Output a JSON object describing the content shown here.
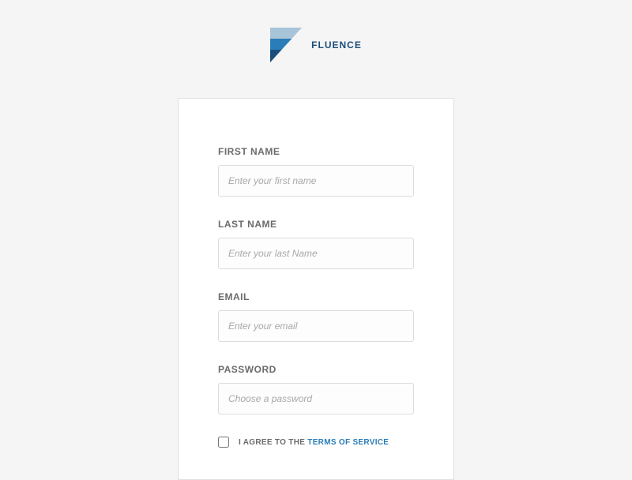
{
  "brand": {
    "name": "FLUENCE"
  },
  "form": {
    "first_name": {
      "label": "FIRST NAME",
      "placeholder": "Enter your first name",
      "value": ""
    },
    "last_name": {
      "label": "LAST NAME",
      "placeholder": "Enter your last Name",
      "value": ""
    },
    "email": {
      "label": "EMAIL",
      "placeholder": "Enter your email",
      "value": ""
    },
    "password": {
      "label": "PASSWORD",
      "placeholder": "Choose a password",
      "value": ""
    },
    "terms": {
      "prefix": "I AGREE TO THE ",
      "link": "TERMS OF SERVICE"
    }
  }
}
